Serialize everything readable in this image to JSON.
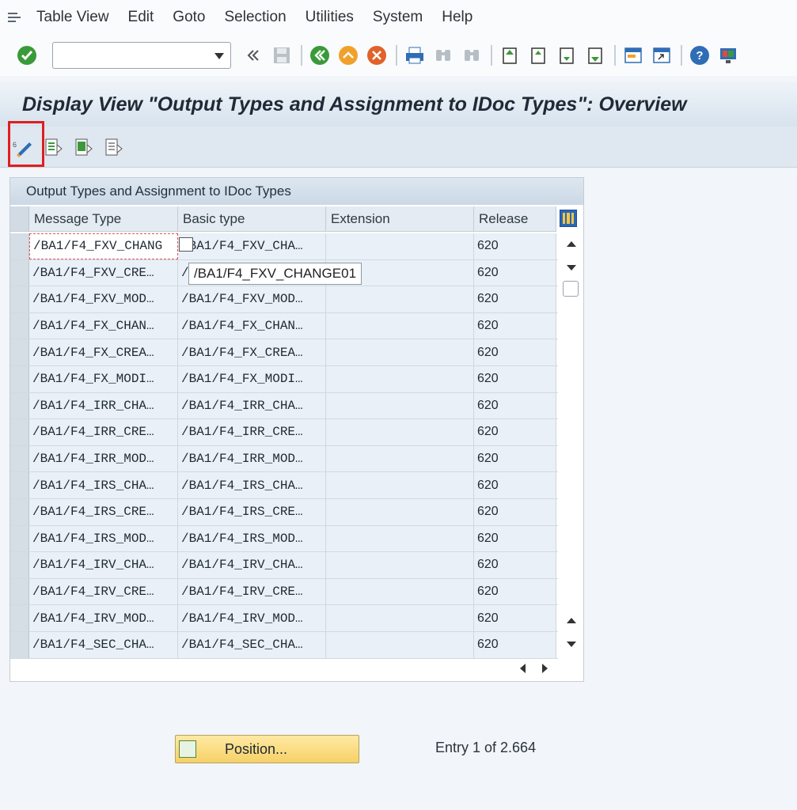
{
  "menu": {
    "items": [
      "Table View",
      "Edit",
      "Goto",
      "Selection",
      "Utilities",
      "System",
      "Help"
    ]
  },
  "toolbar": {
    "command_value": ""
  },
  "title": "Display View \"Output Types and Assignment to IDoc Types\": Overview",
  "table": {
    "caption": "Output Types and Assignment to IDoc Types",
    "columns": [
      "Message Type",
      "Basic type",
      "Extension",
      "Release"
    ],
    "rows": [
      [
        "/BA1/F4_FXV_CHANG",
        "/BA1/F4_FXV_CHA…",
        "",
        "620"
      ],
      [
        "/BA1/F4_FXV_CRE…",
        "/",
        "",
        "620"
      ],
      [
        "/BA1/F4_FXV_MOD…",
        "/BA1/F4_FXV_MOD…",
        "",
        "620"
      ],
      [
        "/BA1/F4_FX_CHAN…",
        "/BA1/F4_FX_CHAN…",
        "",
        "620"
      ],
      [
        "/BA1/F4_FX_CREA…",
        "/BA1/F4_FX_CREA…",
        "",
        "620"
      ],
      [
        "/BA1/F4_FX_MODI…",
        "/BA1/F4_FX_MODI…",
        "",
        "620"
      ],
      [
        "/BA1/F4_IRR_CHA…",
        "/BA1/F4_IRR_CHA…",
        "",
        "620"
      ],
      [
        "/BA1/F4_IRR_CRE…",
        "/BA1/F4_IRR_CRE…",
        "",
        "620"
      ],
      [
        "/BA1/F4_IRR_MOD…",
        "/BA1/F4_IRR_MOD…",
        "",
        "620"
      ],
      [
        "/BA1/F4_IRS_CHA…",
        "/BA1/F4_IRS_CHA…",
        "",
        "620"
      ],
      [
        "/BA1/F4_IRS_CRE…",
        "/BA1/F4_IRS_CRE…",
        "",
        "620"
      ],
      [
        "/BA1/F4_IRS_MOD…",
        "/BA1/F4_IRS_MOD…",
        "",
        "620"
      ],
      [
        "/BA1/F4_IRV_CHA…",
        "/BA1/F4_IRV_CHA…",
        "",
        "620"
      ],
      [
        "/BA1/F4_IRV_CRE…",
        "/BA1/F4_IRV_CRE…",
        "",
        "620"
      ],
      [
        "/BA1/F4_IRV_MOD…",
        "/BA1/F4_IRV_MOD…",
        "",
        "620"
      ],
      [
        "/BA1/F4_SEC_CHA…",
        "/BA1/F4_SEC_CHA…",
        "",
        "620"
      ]
    ],
    "tooltip": "/BA1/F4_FXV_CHANGE01"
  },
  "footer": {
    "position_label": "Position...",
    "entry_text": "Entry 1 of 2.664"
  },
  "colors": {
    "highlight": "#e01e1e",
    "accept": "#3a9a3a",
    "position_btn": "#f6d167"
  }
}
